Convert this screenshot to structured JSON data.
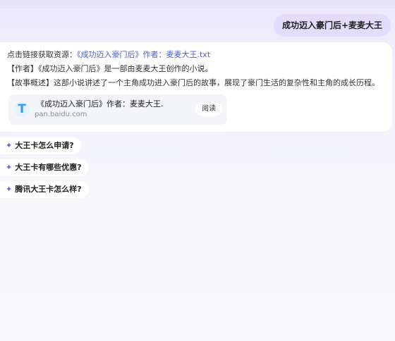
{
  "user_message": "成功迈入豪门后+麦麦大王",
  "answer": {
    "line1_prefix": "点击链接获取资源：",
    "line1_link1": "《成功迈入豪门后》作者：麦麦大王.txt",
    "line2": "【作者】《成功迈入豪门后》是一部由麦麦大王创作的小说。",
    "line3": "【故事概述】这部小说讲述了一个主角成功进入豪门后的故事，展现了豪门生活的复杂性和主角的成长历程。",
    "resource": {
      "logo_letter": "T",
      "title": "《成功迈入豪门后》作者：麦麦大王.",
      "domain": "pan.baidu.com",
      "button": "阅读"
    }
  },
  "suggestions": [
    "大王卡怎么申请?",
    "大王卡有哪些优惠?",
    "腾讯大王卡怎么样?"
  ],
  "colors": {
    "link": "#4a5fd0",
    "sparkle": "#6e5be3",
    "user_bubble": "#e3dcfd"
  }
}
